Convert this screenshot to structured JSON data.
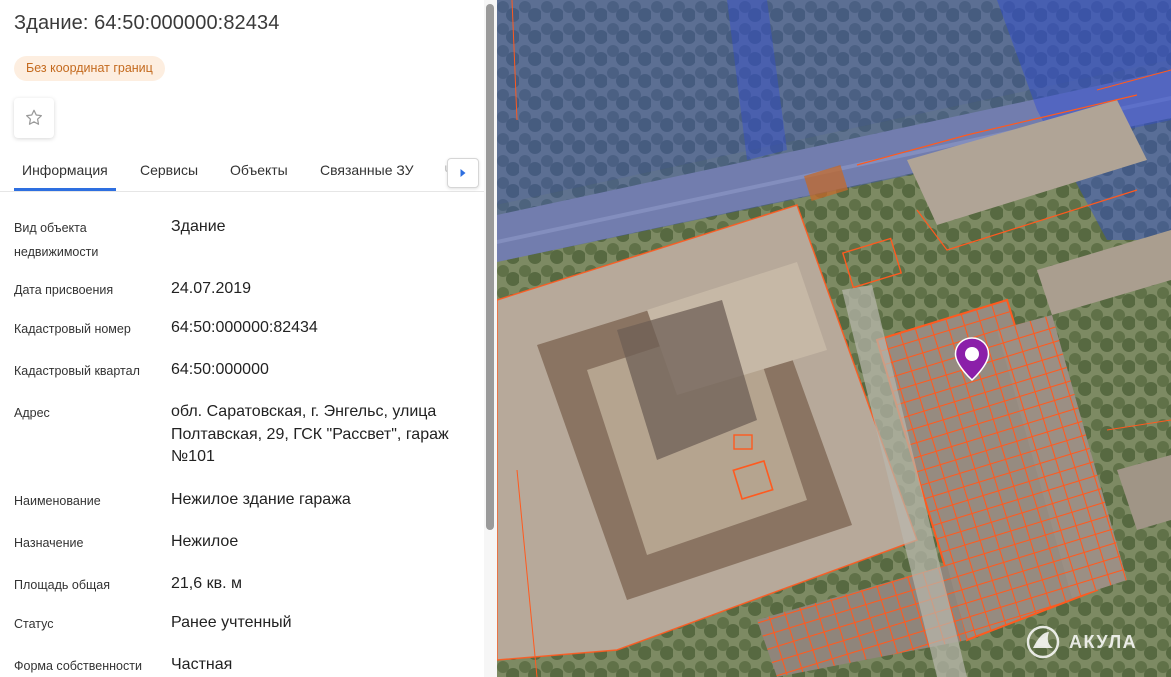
{
  "header": {
    "title": "Здание: 64:50:000000:82434",
    "badge": "Без координат границ"
  },
  "tabs": [
    {
      "label": "Информация",
      "active": true
    },
    {
      "label": "Сервисы",
      "active": false
    },
    {
      "label": "Объекты",
      "active": false
    },
    {
      "label": "Связанные ЗУ",
      "active": false
    },
    {
      "label": "Ч",
      "active": false
    }
  ],
  "info": [
    {
      "label": "Вид объекта недвижимости",
      "value": "Здание"
    },
    {
      "label": "Дата присвоения",
      "value": "24.07.2019"
    },
    {
      "label": "Кадастровый номер",
      "value": "64:50:000000:82434"
    },
    {
      "label": "Кадастровый квартал",
      "value": "64:50:000000"
    },
    {
      "label": "Адрес",
      "value": "обл. Саратовская, г. Энгельс, улица Полтавская, 29, ГСК \"Рассвет\", гараж №101"
    },
    {
      "label": "Наименование",
      "value": "Нежилое здание гаража"
    },
    {
      "label": "Назначение",
      "value": "Нежилое"
    },
    {
      "label": "Площадь общая",
      "value": "21,6 кв. м"
    },
    {
      "label": "Статус",
      "value": "Ранее учтенный"
    },
    {
      "label": "Форма собственности",
      "value": "Частная"
    }
  ],
  "map": {
    "logo_text": "АКУЛА",
    "pin_color": "#8b1fa9",
    "parcel_color": "#ff5a1f",
    "zone_color": "#2f4bd6"
  },
  "icons": {
    "favorite": "star-outline-icon",
    "tab_scroll": "chevron-right-icon",
    "map_pin": "map-pin-icon",
    "logo": "akula-logo-icon"
  }
}
